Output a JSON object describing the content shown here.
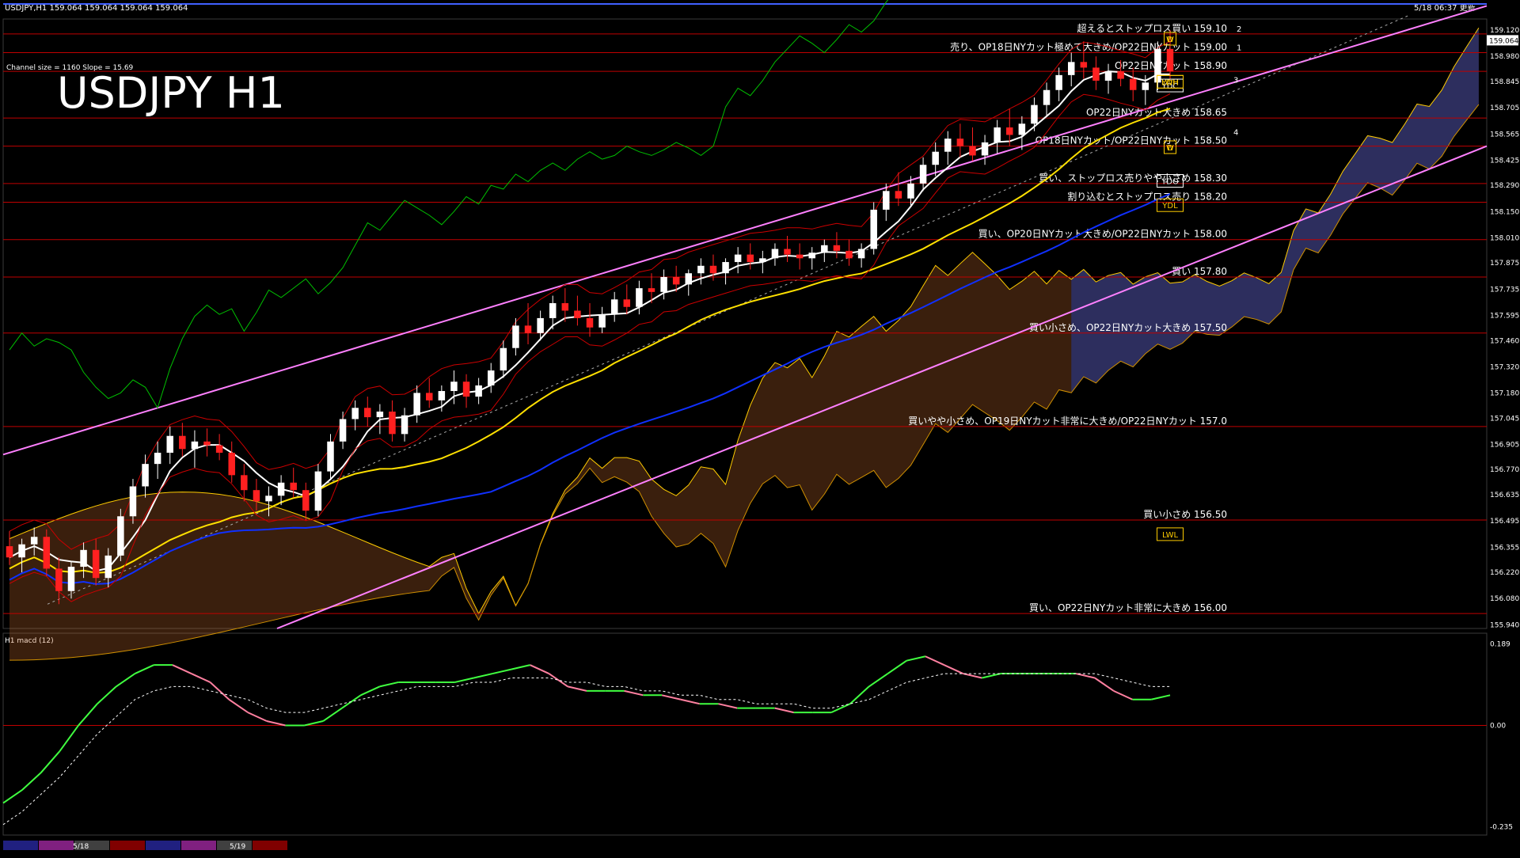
{
  "window": {
    "header": "USDJPY,H1  159.064 159.064 159.064 159.064",
    "timestamp": "5/18 06:37 更新",
    "channel_info": "Channel size = 1160 Slope = 15.69",
    "big_title": "USDJPY H1",
    "macd_label": "H1  macd (12)",
    "current_price_tag": "159.064"
  },
  "colors": {
    "background": "#000000",
    "bull_candle": "#ffffff",
    "bear_candle": "#ff2020",
    "channel": "#ff80ff",
    "level_line": "#c00000",
    "cloud_upper": "#d07030",
    "cloud_lower": "#2040c0",
    "ma_white": "#ffffff",
    "ma_yellow": "#ffe000",
    "ma_blue": "#1030ff",
    "chikou_green": "#00c000",
    "macd_up": "#40ff40",
    "macd_down": "#ff80a0",
    "signal": "#ffffff"
  },
  "chart_data": {
    "type": "candlestick",
    "symbol": "USDJPY",
    "timeframe": "H1",
    "price_axis": {
      "labels": [
        "159.120",
        "158.980",
        "158.845",
        "158.705",
        "158.565",
        "158.425",
        "158.290",
        "158.150",
        "158.010",
        "157.875",
        "157.735",
        "157.595",
        "157.460",
        "157.320",
        "157.180",
        "157.045",
        "156.905",
        "156.770",
        "156.635",
        "156.495",
        "156.355",
        "156.220",
        "156.080",
        "155.940"
      ],
      "ylim": [
        155.92,
        159.18
      ]
    },
    "macd_axis": {
      "labels": [
        "0.189",
        "0.00",
        "-0.235"
      ],
      "ylim": [
        -0.245,
        0.199
      ]
    },
    "date_labels": [
      "5/18",
      "5/19"
    ],
    "levels": [
      {
        "price": 159.1,
        "label": "超えるとストップロス買い 159.10",
        "marker": "2"
      },
      {
        "price": 159.0,
        "label": "売り、OP18日NYカット極めて大きめ/OP22日NYカット 159.00",
        "marker": "1"
      },
      {
        "price": 158.9,
        "label": "OP22日NYカット 158.90",
        "marker": ""
      },
      {
        "price": 158.65,
        "label": "OP22日NYカット大きめ 158.65",
        "marker": ""
      },
      {
        "price": 158.5,
        "label": "OP18日NYカット/OP22日NYカット 158.50",
        "marker": ""
      },
      {
        "price": 158.3,
        "label": "買い、ストップロス売りやや小さめ 158.30",
        "marker": ""
      },
      {
        "price": 158.2,
        "label": "割り込むとストップロス売り 158.20",
        "marker": ""
      },
      {
        "price": 158.0,
        "label": "買い、OP20日NYカット大きめ/OP22日NYカット 158.00",
        "marker": ""
      },
      {
        "price": 157.8,
        "label": "買い 157.80",
        "marker": ""
      },
      {
        "price": 157.5,
        "label": "買い小さめ、OP22日NYカット大きめ 157.50",
        "marker": ""
      },
      {
        "price": 157.0,
        "label": "買いやや小さめ、OP19日NYカット非常に大きめ/OP22日NYカット 157.0",
        "marker": ""
      },
      {
        "price": 156.5,
        "label": "買い小さめ 156.50",
        "marker": ""
      },
      {
        "price": 156.0,
        "label": "買い、OP22日NYカット非常に大きめ 156.00",
        "marker": ""
      }
    ],
    "markers": [
      {
        "text": "YDC",
        "price": 158.82,
        "index": 132
      },
      {
        "text": "YDO",
        "price": 158.31,
        "index": 132
      },
      {
        "text": "LWH",
        "price": 158.84,
        "index": 138
      },
      {
        "text": "YDH",
        "price": 158.84,
        "index": 143
      },
      {
        "text": "YDL",
        "price": 158.18,
        "index": 143
      },
      {
        "text": "LWL",
        "price": 156.42,
        "index": 138
      },
      {
        "text": "W",
        "price": 159.07,
        "index": 151
      },
      {
        "text": "D",
        "price": 159.07,
        "index": 153
      },
      {
        "text": "W",
        "price": 158.49,
        "index": 151
      },
      {
        "text": "D",
        "price": 158.49,
        "index": 153
      }
    ],
    "channel_markers": [
      "3",
      "4"
    ],
    "candles_ohlc": [
      [
        156.36,
        156.44,
        156.26,
        156.3
      ],
      [
        156.3,
        156.4,
        156.22,
        156.37
      ],
      [
        156.37,
        156.46,
        156.31,
        156.41
      ],
      [
        156.41,
        156.45,
        156.2,
        156.24
      ],
      [
        156.24,
        156.3,
        156.05,
        156.12
      ],
      [
        156.12,
        156.28,
        156.08,
        156.25
      ],
      [
        156.25,
        156.38,
        156.19,
        156.34
      ],
      [
        156.34,
        156.4,
        156.15,
        156.19
      ],
      [
        156.19,
        156.35,
        156.14,
        156.31
      ],
      [
        156.31,
        156.56,
        156.28,
        156.52
      ],
      [
        156.52,
        156.72,
        156.48,
        156.68
      ],
      [
        156.68,
        156.85,
        156.62,
        156.8
      ],
      [
        156.8,
        156.92,
        156.72,
        156.86
      ],
      [
        156.86,
        157.0,
        156.8,
        156.95
      ],
      [
        156.95,
        157.02,
        156.84,
        156.88
      ],
      [
        156.88,
        156.98,
        156.78,
        156.92
      ],
      [
        156.92,
        156.99,
        156.84,
        156.9
      ],
      [
        156.9,
        156.96,
        156.82,
        156.86
      ],
      [
        156.86,
        156.92,
        156.7,
        156.74
      ],
      [
        156.74,
        156.8,
        156.6,
        156.66
      ],
      [
        156.66,
        156.72,
        156.55,
        156.6
      ],
      [
        156.6,
        156.68,
        156.52,
        156.63
      ],
      [
        156.63,
        156.74,
        156.58,
        156.7
      ],
      [
        156.7,
        156.78,
        156.62,
        156.66
      ],
      [
        156.66,
        156.7,
        156.5,
        156.55
      ],
      [
        156.55,
        156.8,
        156.52,
        156.76
      ],
      [
        156.76,
        156.96,
        156.72,
        156.92
      ],
      [
        156.92,
        157.08,
        156.88,
        157.04
      ],
      [
        157.04,
        157.14,
        156.98,
        157.1
      ],
      [
        157.1,
        157.16,
        157.0,
        157.05
      ],
      [
        157.05,
        157.12,
        156.96,
        157.08
      ],
      [
        157.08,
        157.14,
        156.92,
        156.96
      ],
      [
        156.96,
        157.1,
        156.92,
        157.06
      ],
      [
        157.06,
        157.22,
        157.02,
        157.18
      ],
      [
        157.18,
        157.26,
        157.1,
        157.14
      ],
      [
        157.14,
        157.22,
        157.08,
        157.19
      ],
      [
        157.19,
        157.3,
        157.12,
        157.24
      ],
      [
        157.24,
        157.28,
        157.1,
        157.16
      ],
      [
        157.16,
        157.26,
        157.12,
        157.22
      ],
      [
        157.22,
        157.34,
        157.18,
        157.3
      ],
      [
        157.3,
        157.46,
        157.26,
        157.42
      ],
      [
        157.42,
        157.58,
        157.38,
        157.54
      ],
      [
        157.54,
        157.66,
        157.44,
        157.5
      ],
      [
        157.5,
        157.62,
        157.46,
        157.58
      ],
      [
        157.58,
        157.7,
        157.52,
        157.66
      ],
      [
        157.66,
        157.74,
        157.56,
        157.62
      ],
      [
        157.62,
        157.7,
        157.54,
        157.58
      ],
      [
        157.58,
        157.66,
        157.48,
        157.53
      ],
      [
        157.53,
        157.64,
        157.5,
        157.6
      ],
      [
        157.6,
        157.72,
        157.56,
        157.68
      ],
      [
        157.68,
        157.76,
        157.6,
        157.64
      ],
      [
        157.64,
        157.78,
        157.6,
        157.74
      ],
      [
        157.74,
        157.82,
        157.66,
        157.72
      ],
      [
        157.72,
        157.84,
        157.68,
        157.8
      ],
      [
        157.8,
        157.86,
        157.72,
        157.76
      ],
      [
        157.76,
        157.84,
        157.7,
        157.82
      ],
      [
        157.82,
        157.9,
        157.76,
        157.86
      ],
      [
        157.86,
        157.92,
        157.78,
        157.82
      ],
      [
        157.82,
        157.9,
        157.76,
        157.88
      ],
      [
        157.88,
        157.96,
        157.82,
        157.92
      ],
      [
        157.92,
        157.98,
        157.84,
        157.88
      ],
      [
        157.88,
        157.94,
        157.82,
        157.9
      ],
      [
        157.9,
        157.98,
        157.86,
        157.95
      ],
      [
        157.95,
        158.02,
        157.88,
        157.92
      ],
      [
        157.92,
        157.98,
        157.84,
        157.9
      ],
      [
        157.9,
        157.96,
        157.84,
        157.93
      ],
      [
        157.93,
        158.0,
        157.88,
        157.97
      ],
      [
        157.97,
        158.04,
        157.9,
        157.94
      ],
      [
        157.94,
        158.0,
        157.86,
        157.9
      ],
      [
        157.9,
        157.98,
        157.85,
        157.95
      ],
      [
        157.95,
        158.2,
        157.92,
        158.16
      ],
      [
        158.16,
        158.3,
        158.1,
        158.26
      ],
      [
        158.26,
        158.36,
        158.18,
        158.22
      ],
      [
        158.22,
        158.34,
        158.18,
        158.3
      ],
      [
        158.3,
        158.44,
        158.26,
        158.4
      ],
      [
        158.4,
        158.52,
        158.34,
        158.47
      ],
      [
        158.47,
        158.58,
        158.4,
        158.54
      ],
      [
        158.54,
        158.62,
        158.44,
        158.5
      ],
      [
        158.5,
        158.6,
        158.42,
        158.45
      ],
      [
        158.45,
        158.56,
        158.4,
        158.52
      ],
      [
        158.52,
        158.64,
        158.46,
        158.6
      ],
      [
        158.6,
        158.7,
        158.5,
        158.56
      ],
      [
        158.56,
        158.66,
        158.48,
        158.62
      ],
      [
        158.62,
        158.76,
        158.58,
        158.72
      ],
      [
        158.72,
        158.84,
        158.66,
        158.8
      ],
      [
        158.8,
        158.92,
        158.74,
        158.88
      ],
      [
        158.88,
        159.0,
        158.82,
        158.95
      ],
      [
        158.95,
        159.06,
        158.86,
        158.92
      ],
      [
        158.92,
        158.98,
        158.8,
        158.85
      ],
      [
        158.85,
        158.94,
        158.78,
        158.9
      ],
      [
        158.9,
        158.96,
        158.82,
        158.86
      ],
      [
        158.86,
        158.92,
        158.74,
        158.8
      ],
      [
        158.8,
        158.88,
        158.72,
        158.84
      ],
      [
        158.84,
        159.06,
        158.8,
        159.02
      ],
      [
        159.02,
        159.12,
        158.86,
        158.9
      ]
    ],
    "macd": {
      "main": [
        -0.18,
        -0.15,
        -0.11,
        -0.06,
        0.0,
        0.05,
        0.09,
        0.12,
        0.14,
        0.14,
        0.12,
        0.1,
        0.06,
        0.03,
        0.01,
        0.0,
        0.0,
        0.01,
        0.04,
        0.07,
        0.09,
        0.1,
        0.1,
        0.1,
        0.1,
        0.11,
        0.12,
        0.13,
        0.14,
        0.12,
        0.09,
        0.08,
        0.08,
        0.08,
        0.07,
        0.07,
        0.06,
        0.05,
        0.05,
        0.04,
        0.04,
        0.04,
        0.03,
        0.03,
        0.03,
        0.05,
        0.09,
        0.12,
        0.15,
        0.16,
        0.14,
        0.12,
        0.11,
        0.12,
        0.12,
        0.12,
        0.12,
        0.12,
        0.11,
        0.08,
        0.06,
        0.06,
        0.07
      ],
      "signal": [
        -0.23,
        -0.2,
        -0.16,
        -0.12,
        -0.07,
        -0.02,
        0.02,
        0.06,
        0.08,
        0.09,
        0.09,
        0.08,
        0.07,
        0.06,
        0.04,
        0.03,
        0.03,
        0.04,
        0.05,
        0.06,
        0.07,
        0.08,
        0.09,
        0.09,
        0.09,
        0.1,
        0.1,
        0.11,
        0.11,
        0.11,
        0.1,
        0.1,
        0.09,
        0.09,
        0.08,
        0.08,
        0.07,
        0.07,
        0.06,
        0.06,
        0.05,
        0.05,
        0.05,
        0.04,
        0.04,
        0.05,
        0.06,
        0.08,
        0.1,
        0.11,
        0.12,
        0.12,
        0.12,
        0.12,
        0.12,
        0.12,
        0.12,
        0.12,
        0.12,
        0.11,
        0.1,
        0.09,
        0.09
      ]
    }
  }
}
